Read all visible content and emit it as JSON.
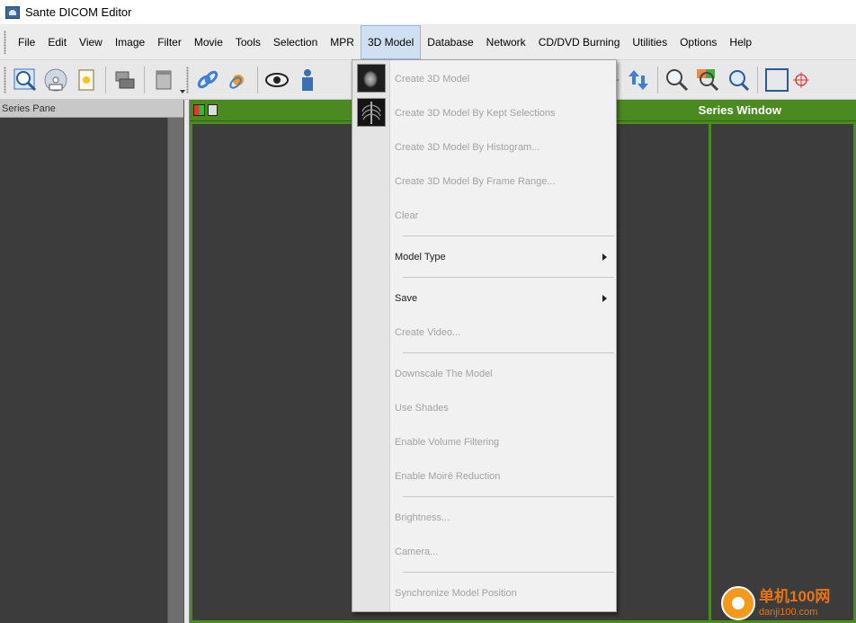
{
  "window": {
    "title": "Sante DICOM Editor"
  },
  "menubar": {
    "items": [
      "File",
      "Edit",
      "View",
      "Image",
      "Filter",
      "Movie",
      "Tools",
      "Selection",
      "MPR",
      "3D Model",
      "Database",
      "Network",
      "CD/DVD Burning",
      "Utilities",
      "Options",
      "Help"
    ],
    "active": "3D Model"
  },
  "series_pane": {
    "header": "Series Pane"
  },
  "series_window": {
    "title": "Series Window"
  },
  "dropdown": {
    "items": [
      {
        "label": "Create 3D Model",
        "enabled": false,
        "icon": "head-model-thumbnail-icon"
      },
      {
        "label": "Create 3D Model By Kept Selections",
        "enabled": false,
        "icon": "ribcage-thumbnail-icon"
      },
      {
        "label": "Create 3D Model By Histogram...",
        "enabled": false
      },
      {
        "label": "Create 3D Model By Frame Range...",
        "enabled": false
      },
      {
        "label": "Clear",
        "enabled": false
      },
      {
        "label": "Model Type",
        "enabled": true,
        "submenu": true
      },
      {
        "label": "Save",
        "enabled": true,
        "submenu": true
      },
      {
        "label": "Create Video...",
        "enabled": false
      },
      {
        "label": "Downscale The Model",
        "enabled": false
      },
      {
        "label": "Use Shades",
        "enabled": false
      },
      {
        "label": "Enable Volume Filtering",
        "enabled": false
      },
      {
        "label": "Enable Moiré Reduction",
        "enabled": false
      },
      {
        "label": "Brightness...",
        "enabled": false
      },
      {
        "label": "Camera...",
        "enabled": false
      },
      {
        "label": "Synchronize Model Position",
        "enabled": false
      }
    ]
  },
  "toolbar": {
    "buttons": [
      "open-image-icon",
      "cd-icon",
      "document-icon",
      "print-icon",
      "panel-icon",
      "link-icon",
      "unlink-icon",
      "eye-icon",
      "person-icon",
      "brightness-icon",
      "up-down-arrow-icon",
      "zoom-icon",
      "zoom-color-icon",
      "zoom-fit-icon",
      "rectangle-icon",
      "crosshair-icon"
    ]
  },
  "watermark": {
    "brand": "单机100网",
    "url": "danji100.com"
  },
  "colors": {
    "accent_green": "#4a8a20",
    "menu_active": "#cfe0f3",
    "disabled_text": "#a2a2a2"
  }
}
